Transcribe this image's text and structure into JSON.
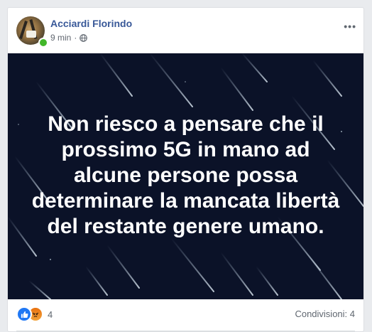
{
  "post": {
    "author": "Acciardi Florindo",
    "time": "9 min",
    "separator": "·",
    "privacy_icon": "globe-icon",
    "more_icon": "more-options-icon",
    "text_lines": [
      "Non riesco a pensare che il",
      "prossimo 5G in mano ad",
      "alcune persone possa",
      "determinare la mancata libertà",
      "del restante genere umano."
    ],
    "background_color": "#0b1228",
    "text_color": "#ffffff"
  },
  "footer": {
    "reaction_icons": [
      "like-icon",
      "angry-icon"
    ],
    "reaction_count": "4",
    "shares_label": "Condivisioni: 4"
  },
  "colors": {
    "author_link": "#385898",
    "like_blue": "#2078f4",
    "angry_orange": "#e9710f",
    "online_green": "#42b72a"
  }
}
